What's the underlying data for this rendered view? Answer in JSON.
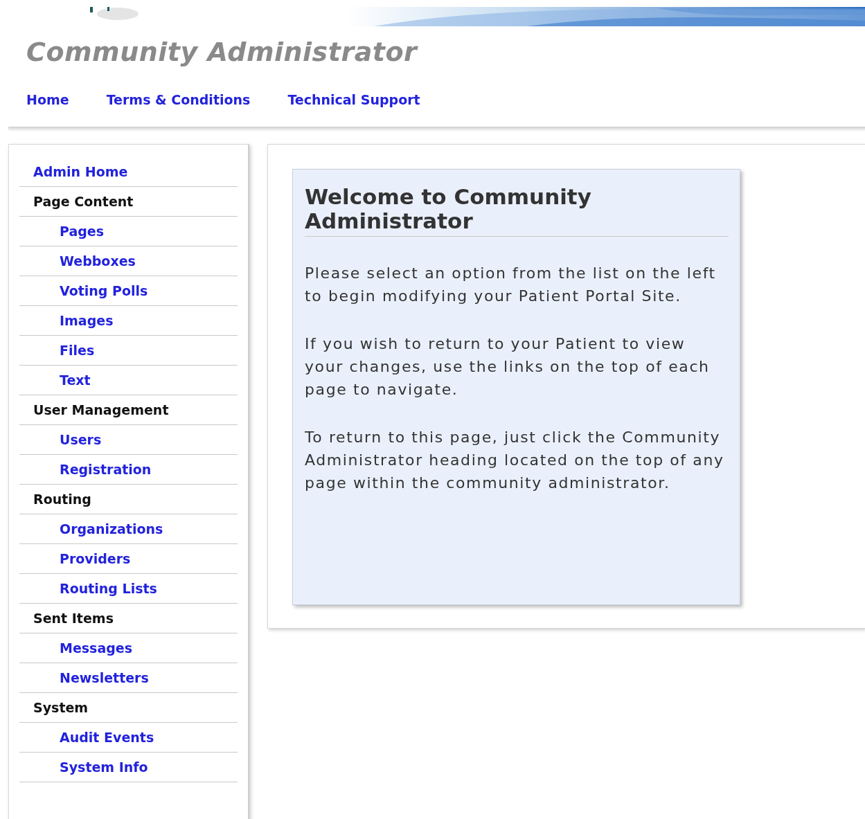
{
  "header": {
    "title": "Community Administrator"
  },
  "top_nav": [
    {
      "label": "Home"
    },
    {
      "label": "Terms & Conditions"
    },
    {
      "label": "Technical Support"
    }
  ],
  "sidebar": {
    "items": [
      {
        "label": "Admin Home",
        "kind": "link"
      },
      {
        "label": "Page Content",
        "kind": "heading",
        "children": [
          {
            "label": "Pages"
          },
          {
            "label": "Webboxes"
          },
          {
            "label": "Voting Polls"
          },
          {
            "label": "Images"
          },
          {
            "label": "Files"
          },
          {
            "label": "Text"
          }
        ]
      },
      {
        "label": "User Management",
        "kind": "heading",
        "children": [
          {
            "label": "Users"
          },
          {
            "label": "Registration"
          }
        ]
      },
      {
        "label": "Routing",
        "kind": "heading",
        "children": [
          {
            "label": "Organizations"
          },
          {
            "label": "Providers"
          },
          {
            "label": "Routing Lists"
          }
        ]
      },
      {
        "label": "Sent Items",
        "kind": "heading",
        "children": [
          {
            "label": "Messages"
          },
          {
            "label": "Newsletters"
          }
        ]
      },
      {
        "label": "System",
        "kind": "heading",
        "children": [
          {
            "label": "Audit Events"
          },
          {
            "label": "System Info"
          }
        ]
      }
    ]
  },
  "welcome": {
    "title": "Welcome to Community Administrator",
    "paragraphs": [
      "Please select an option from the list on the left to begin modifying your Patient Portal Site.",
      "If you wish to return to your Patient to view your changes, use the links on the top of each page to navigate.",
      "To return to this page, just click the Community Administrator heading located on the top of any page within the community administrator."
    ]
  }
}
